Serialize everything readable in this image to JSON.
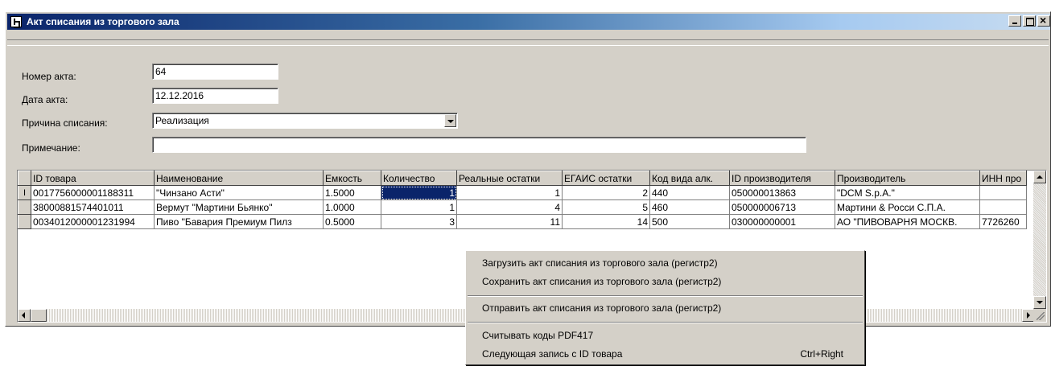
{
  "window": {
    "title": "Акт списания из торгового зала"
  },
  "form": {
    "act_number_label": "Номер акта:",
    "act_number_value": "64",
    "act_date_label": "Дата акта:",
    "act_date_value": "12.12.2016",
    "reason_label": "Причина списания:",
    "reason_value": "Реализация",
    "note_label": "Примечание:",
    "note_value": ""
  },
  "grid": {
    "columns": [
      "ID товара",
      "Наименование",
      "Емкость",
      "Количество",
      "Реальные остатки",
      "ЕГАИС остатки",
      "Код вида алк.",
      "ID производителя",
      "Производитель",
      "ИНН про"
    ],
    "row_indicator": "I",
    "rows": [
      [
        "0017756000001188311",
        "\"Чинзано Асти\"",
        "1.5000",
        "1",
        "1",
        "2",
        "440",
        "050000013863",
        "\"DCM S.p.A.\"",
        ""
      ],
      [
        "38000881574401011",
        "Вермут \"Мартини Бьянко\"",
        "1.0000",
        "1",
        "4",
        "5",
        "460",
        "050000006713",
        "Мартини & Росси С.П.А.",
        ""
      ],
      [
        "0034012000001231994",
        "Пиво \"Бавария Премиум Пилз",
        "0.5000",
        "3",
        "11",
        "14",
        "500",
        "030000000001",
        "АО \"ПИВОВАРНЯ МОСКВ.",
        "7726260"
      ]
    ]
  },
  "context_menu": {
    "items": [
      "Загрузить акт списания из торгового зала (регистр2)",
      "Сохранить акт списания  из торгового зала (регистр2)",
      "Отправить акт списания  из торгового зала (регистр2)",
      "Считывать коды PDF417",
      "Следующая запись с  ID товара"
    ],
    "shortcut": "Ctrl+Right"
  },
  "colors": {
    "title_start": "#0a246a",
    "title_end": "#a6caf0",
    "face": "#d4d0c8",
    "selection": "#0a246a"
  }
}
